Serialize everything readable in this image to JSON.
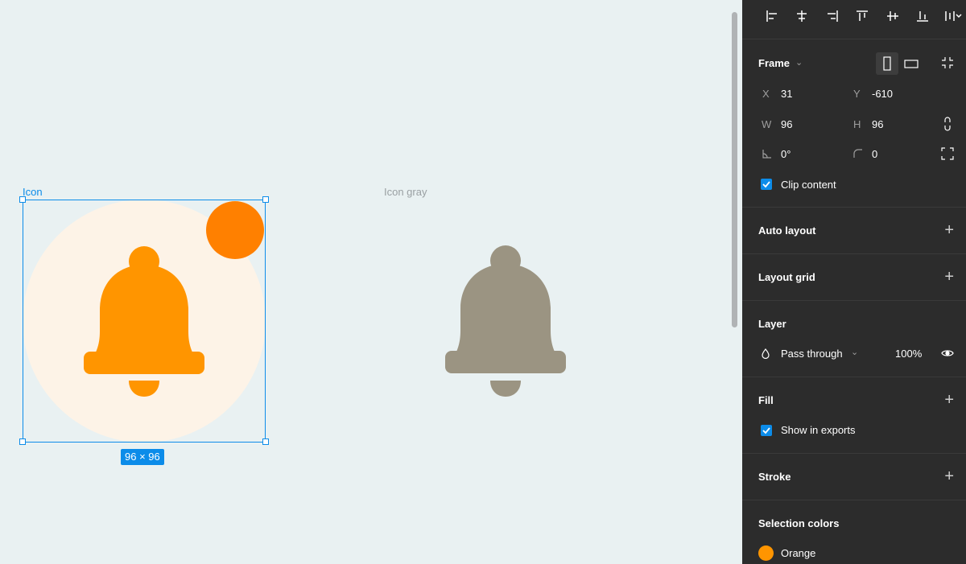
{
  "canvas": {
    "frames": [
      {
        "label": "Icon",
        "selected": true,
        "size_badge": "96 × 96"
      },
      {
        "label": "Icon gray",
        "selected": false
      }
    ],
    "colors": {
      "icon_bg": "#fdf3e7",
      "bell_orange": "#ff9500",
      "dot_orange": "#ff8000",
      "bell_gray": "#9b9482",
      "selection": "#0c8ce9"
    }
  },
  "panel": {
    "align_icons": [
      "align-left-icon",
      "align-horizontal-center-icon",
      "align-right-icon",
      "align-top-icon",
      "align-vertical-center-icon",
      "align-bottom-icon",
      "distribute-icon"
    ],
    "frame": {
      "title": "Frame",
      "x_label": "X",
      "x_value": "31",
      "y_label": "Y",
      "y_value": "-610",
      "w_label": "W",
      "w_value": "96",
      "h_label": "H",
      "h_value": "96",
      "rotation": "0°",
      "radius": "0",
      "clip_content": "Clip content"
    },
    "auto_layout": {
      "title": "Auto layout"
    },
    "layout_grid": {
      "title": "Layout grid"
    },
    "layer": {
      "title": "Layer",
      "blend": "Pass through",
      "opacity": "100%"
    },
    "fill": {
      "title": "Fill",
      "show_in_exports": "Show in exports"
    },
    "stroke": {
      "title": "Stroke"
    },
    "selection_colors": {
      "title": "Selection colors",
      "color_name": "Orange",
      "color_hex": "#ff9500"
    }
  }
}
